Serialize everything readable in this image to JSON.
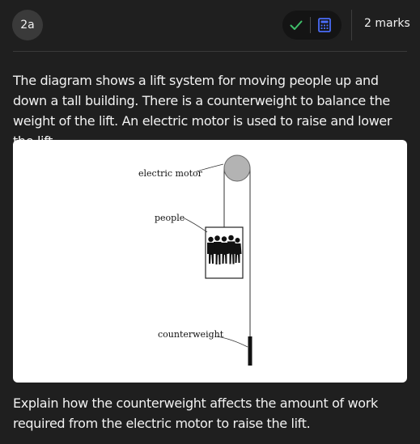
{
  "header": {
    "question_number": "2a",
    "marks": "2 marks"
  },
  "icons": {
    "answered": "check-icon",
    "calculator": "calculator-icon"
  },
  "colors": {
    "check": "#3fbf6a",
    "calculator": "#4a6cf7"
  },
  "intro_text": "The diagram shows a lift system for moving people up and down a tall building. There is a counterweight to balance the weight of the lift. An electric motor is used to raise and lower the lift.",
  "diagram": {
    "labels": {
      "motor": "electric motor",
      "people": "people",
      "counterweight": "counterweight"
    }
  },
  "question_text": "Explain how the counterweight affects the amount of work required from the electric motor to raise the lift."
}
